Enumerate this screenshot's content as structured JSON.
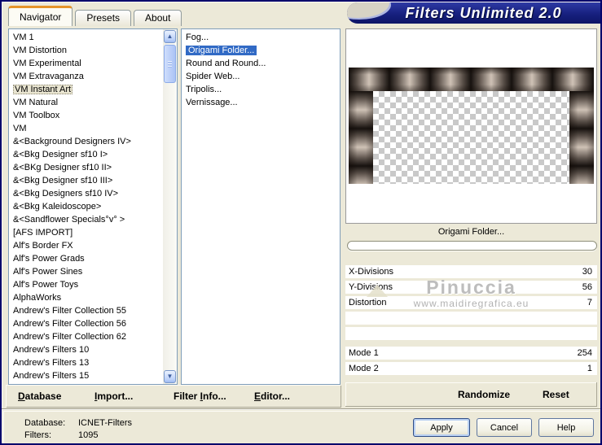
{
  "title": "Filters Unlimited 2.0",
  "tabs": [
    {
      "label": "Navigator",
      "active": true
    },
    {
      "label": "Presets",
      "active": false
    },
    {
      "label": "About",
      "active": false
    }
  ],
  "categories": [
    "VM 1",
    "VM Distortion",
    "VM Experimental",
    "VM Extravaganza",
    "VM Instant Art",
    "VM Natural",
    "VM Toolbox",
    "VM",
    "&<Background Designers IV>",
    "&<Bkg Designer sf10 I>",
    "&<BKg Designer sf10 II>",
    "&<Bkg Designer sf10 III>",
    "&<Bkg Designers sf10 IV>",
    "&<Bkg Kaleidoscope>",
    "&<Sandflower Specials°v° >",
    "[AFS IMPORT]",
    "Alf's Border FX",
    "Alf's Power Grads",
    "Alf's Power Sines",
    "Alf's Power Toys",
    "AlphaWorks",
    "Andrew's Filter Collection 55",
    "Andrew's Filter Collection 56",
    "Andrew's Filter Collection 62",
    "Andrew's Filters 10",
    "Andrew's Filters 13",
    "Andrew's Filters 15"
  ],
  "selected_category": "VM Instant Art",
  "filters": [
    "Fog...",
    "Origami Folder...",
    "Round and Round...",
    "Spider Web...",
    "Tripolis...",
    "Vernissage..."
  ],
  "selected_filter": "Origami Folder...",
  "preview": {
    "filter_label": "Origami Folder..."
  },
  "params": [
    {
      "name": "X-Divisions",
      "value": "30"
    },
    {
      "name": "Y-Divisions",
      "value": "56"
    },
    {
      "name": "Distortion",
      "value": "7"
    },
    {
      "name": "",
      "value": ""
    },
    {
      "name": "",
      "value": ""
    },
    {
      "name": "Mode 1",
      "value": "254"
    },
    {
      "name": "Mode 2",
      "value": "1"
    }
  ],
  "watermark": {
    "line1": "Pinuccia",
    "line2": "www.maidiregrafica.eu"
  },
  "actions": {
    "randomize": "Randomize",
    "reset": "Reset"
  },
  "toolbar": {
    "items": [
      {
        "pre": "",
        "accel": "D",
        "post": "atabase"
      },
      {
        "pre": "",
        "accel": "I",
        "post": "mport..."
      },
      {
        "pre": "Filter ",
        "accel": "I",
        "post": "nfo..."
      },
      {
        "pre": "",
        "accel": "E",
        "post": "ditor..."
      }
    ]
  },
  "status": {
    "database_label": "Database:",
    "database_value": "ICNET-Filters",
    "filters_label": "Filters:",
    "filters_value": "1095"
  },
  "buttons": {
    "apply": "Apply",
    "cancel": "Cancel",
    "help": "Help"
  },
  "icons": {
    "scroll_up": "▲",
    "scroll_down": "▼"
  },
  "colors": {
    "background": "#ece9d8",
    "banner_navy": "#17207f",
    "tab_accent_orange": "#e5942a",
    "selection_blue": "#316ac5",
    "inactive_selection_beige": "#e9e5d1"
  }
}
